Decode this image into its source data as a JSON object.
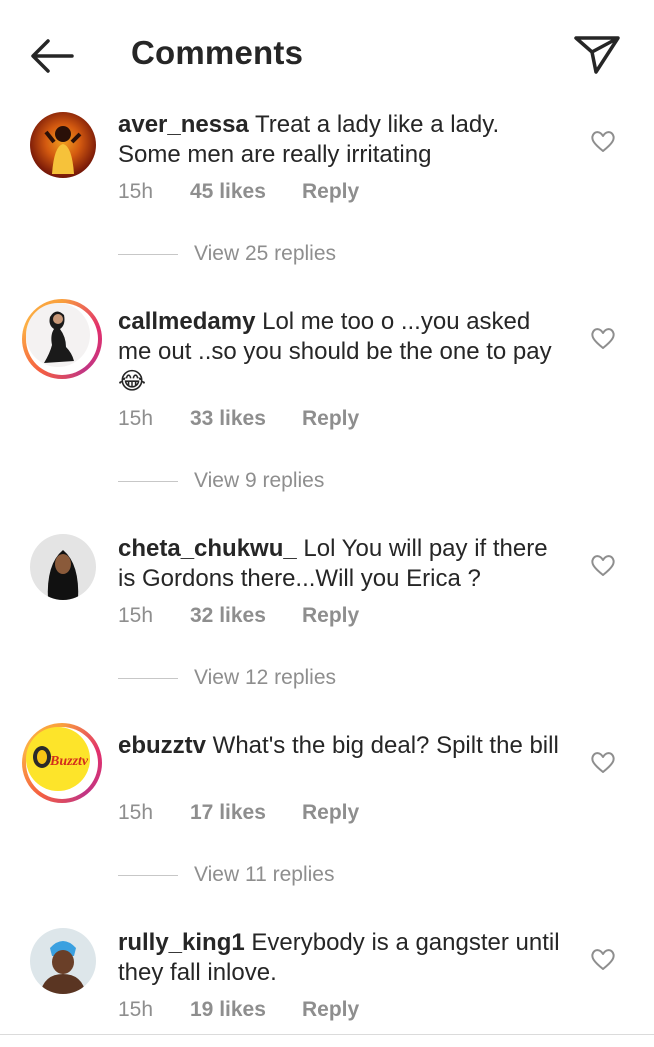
{
  "header": {
    "title": "Comments",
    "back_icon": "arrow-left-icon",
    "send_icon": "paper-plane-icon"
  },
  "comments": [
    {
      "user": "aver_nessa",
      "text": " Treat a lady like a lady. Some men are really irritating",
      "time": "15h",
      "likes": "45 likes",
      "reply": "Reply",
      "view_replies": "View 25 replies"
    },
    {
      "user": "callmedamy",
      "text": " Lol me too o ...you asked me out ..so you should be the one to pay 😂",
      "time": "15h",
      "likes": "33 likes",
      "reply": "Reply",
      "view_replies": "View 9 replies"
    },
    {
      "user": "cheta_chukwu_",
      "text": " Lol You will pay if there is Gordons there...Will you Erica ?",
      "time": "15h",
      "likes": "32 likes",
      "reply": "Reply",
      "view_replies": "View 12 replies"
    },
    {
      "user": "ebuzztv",
      "text": " What's the big deal? Spilt the bill",
      "time": "15h",
      "likes": "17 likes",
      "reply": "Reply",
      "view_replies": "View 11 replies",
      "avatar_text": "Buzztv"
    },
    {
      "user": "rully_king1",
      "text": " Everybody is a gangster until they fall inlove.",
      "time": "15h",
      "likes": "19 likes",
      "reply": "Reply"
    }
  ],
  "colors": {
    "text": "#262626",
    "muted": "#8e8e8e",
    "story_ring": "#e1306c"
  }
}
